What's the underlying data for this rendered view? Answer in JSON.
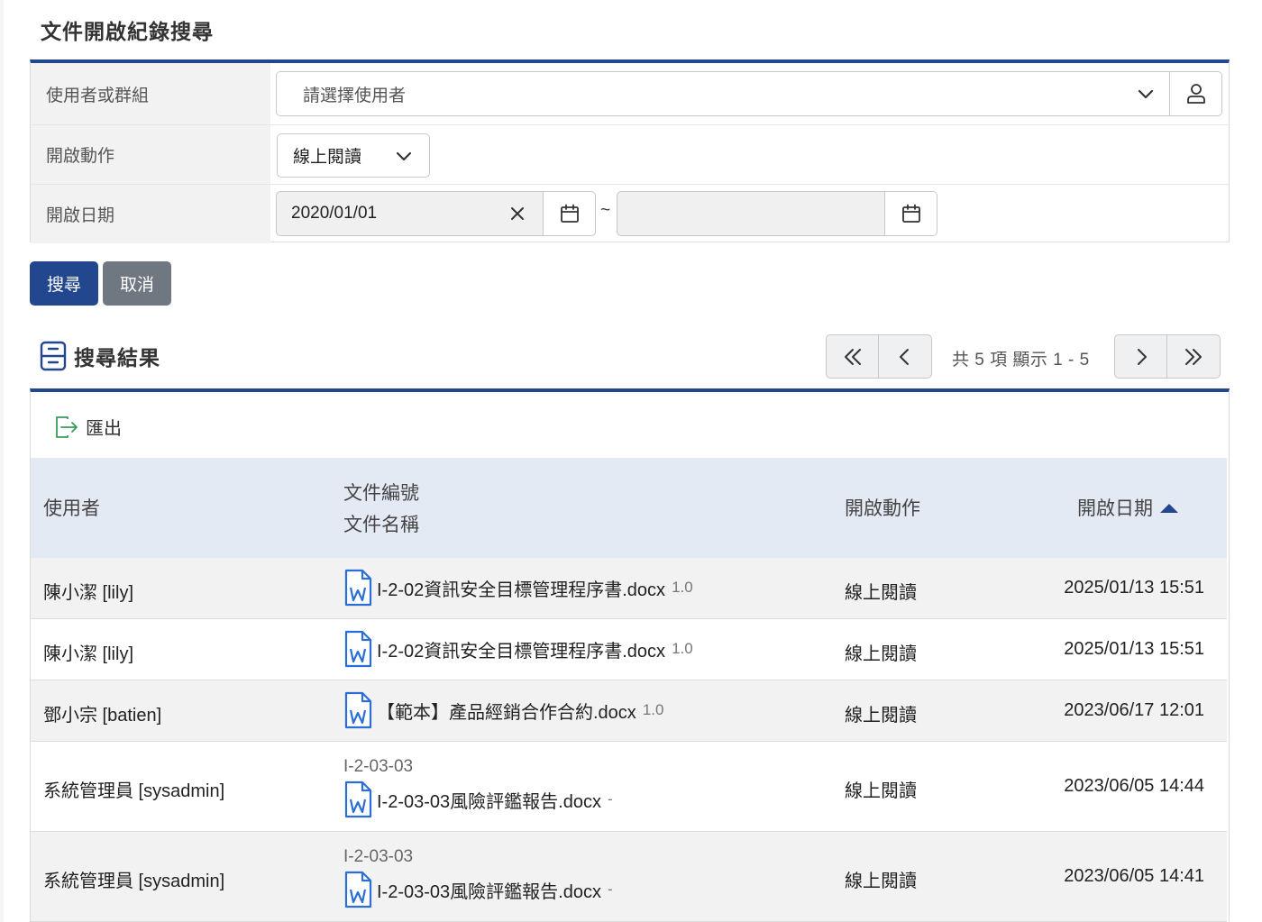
{
  "page": {
    "title": "文件開啟紀錄搜尋"
  },
  "form": {
    "user_label": "使用者或群組",
    "user_placeholder": "請選擇使用者",
    "action_label": "開啟動作",
    "action_value": "線上閱讀",
    "date_label": "開啟日期",
    "date_from": "2020/01/01",
    "date_to": "",
    "date_separator": "~"
  },
  "buttons": {
    "search": "搜尋",
    "cancel": "取消"
  },
  "results": {
    "title": "搜尋結果",
    "pager_info": "共 5 項  顯示 1 - 5",
    "export_label": "匯出",
    "columns": {
      "user": "使用者",
      "doc_no": "文件編號",
      "doc_name": "文件名稱",
      "action": "開啟動作",
      "date": "開啟日期"
    },
    "rows": [
      {
        "user": "陳小潔 [lily]",
        "doc_no": "",
        "doc_name": "I-2-02資訊安全目標管理程序書.docx",
        "version": "1.0",
        "action": "線上閱讀",
        "date": "2025/01/13 15:51"
      },
      {
        "user": "陳小潔 [lily]",
        "doc_no": "",
        "doc_name": "I-2-02資訊安全目標管理程序書.docx",
        "version": "1.0",
        "action": "線上閱讀",
        "date": "2025/01/13 15:51"
      },
      {
        "user": "鄧小宗 [batien]",
        "doc_no": "",
        "doc_name": "【範本】產品經銷合作合約.docx",
        "version": "1.0",
        "action": "線上閱讀",
        "date": "2023/06/17 12:01"
      },
      {
        "user": "系統管理員 [sysadmin]",
        "doc_no": "I-2-03-03",
        "doc_name": "I-2-03-03風險評鑑報告.docx",
        "version": "-",
        "action": "線上閱讀",
        "date": "2023/06/05 14:44"
      },
      {
        "user": "系統管理員 [sysadmin]",
        "doc_no": "I-2-03-03",
        "doc_name": "I-2-03-03風險評鑑報告.docx",
        "version": "-",
        "action": "線上閱讀",
        "date": "2023/06/05 14:41"
      }
    ]
  },
  "colors": {
    "primary": "#23478f",
    "cancel": "#6f7780",
    "header_bg": "#e4eaf4",
    "word_icon": "#2b6fd6",
    "export_icon": "#3a9a5b"
  },
  "icons": {
    "dropdown": "chevron-down-icon",
    "user_pick": "user-icon",
    "calendar": "calendar-icon",
    "clear": "close-icon",
    "results": "archive-icon",
    "export": "export-icon",
    "word": "word-file-icon",
    "sort": "sort-asc-icon"
  }
}
